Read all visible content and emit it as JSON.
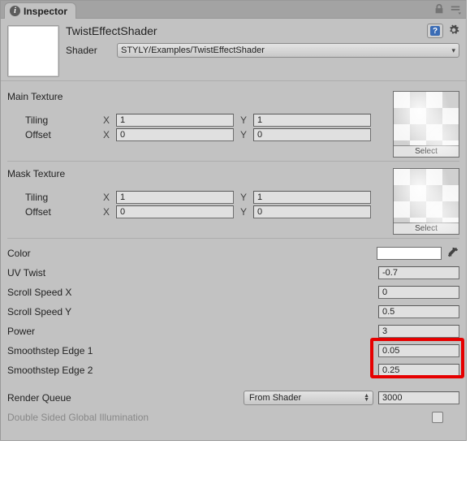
{
  "tab": {
    "title": "Inspector"
  },
  "header": {
    "material_name": "TwistEffectShader",
    "shader_label": "Shader",
    "shader_value": "STYLY/Examples/TwistEffectShader"
  },
  "textures": [
    {
      "label": "Main Texture",
      "tiling_label": "Tiling",
      "offset_label": "Offset",
      "tiling_x": "1",
      "tiling_y": "1",
      "offset_x": "0",
      "offset_y": "0",
      "select_label": "Select"
    },
    {
      "label": "Mask Texture",
      "tiling_label": "Tiling",
      "offset_label": "Offset",
      "tiling_x": "1",
      "tiling_y": "1",
      "offset_x": "0",
      "offset_y": "0",
      "select_label": "Select"
    }
  ],
  "xy": {
    "x": "X",
    "y": "Y"
  },
  "props": {
    "color_label": "Color",
    "uv_twist_label": "UV Twist",
    "uv_twist": "-0.7",
    "scroll_x_label": "Scroll Speed X",
    "scroll_x": "0",
    "scroll_y_label": "Scroll Speed Y",
    "scroll_y": "0.5",
    "power_label": "Power",
    "power": "3",
    "ss1_label": "Smoothstep Edge 1",
    "ss1": "0.05",
    "ss2_label": "Smoothstep Edge 2",
    "ss2": "0.25"
  },
  "render_queue": {
    "label": "Render Queue",
    "mode": "From Shader",
    "value": "3000"
  },
  "dsgi_label": "Double Sided Global Illumination"
}
